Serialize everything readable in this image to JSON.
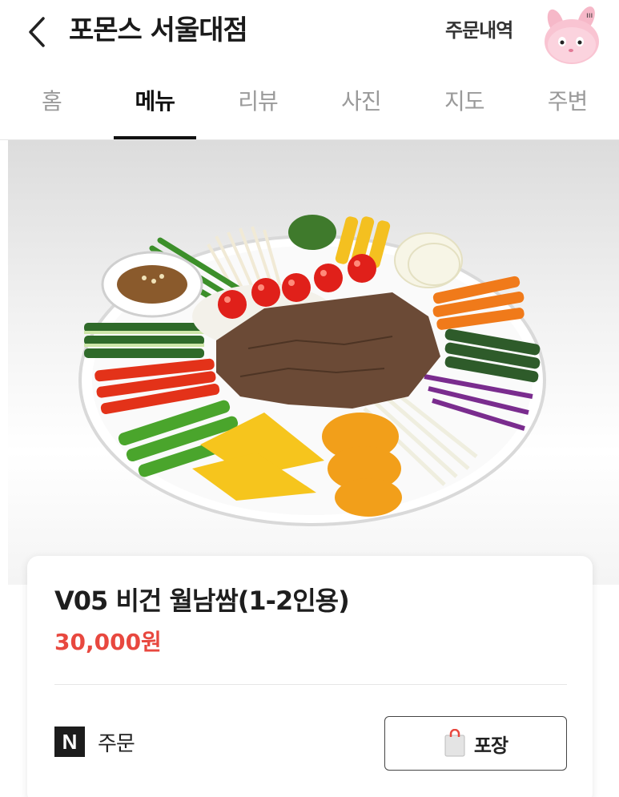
{
  "header": {
    "title": "포몬스 서울대점",
    "orders_label": "주문내역"
  },
  "tabs": [
    {
      "label": "홈",
      "active": false
    },
    {
      "label": "메뉴",
      "active": true
    },
    {
      "label": "리뷰",
      "active": false
    },
    {
      "label": "사진",
      "active": false
    },
    {
      "label": "지도",
      "active": false
    },
    {
      "label": "주변",
      "active": false
    }
  ],
  "hero": {
    "image": "vegan-spring-roll-platter"
  },
  "item": {
    "name": "V05 비건 월남쌈(1-2인용)",
    "price": "30,000원"
  },
  "actions": {
    "order_logo": "N",
    "order_label": "주문",
    "pack_label": "포장"
  },
  "colors": {
    "price": "#e8483f",
    "active_tab": "#111111",
    "inactive_tab": "#9a9a9a"
  }
}
